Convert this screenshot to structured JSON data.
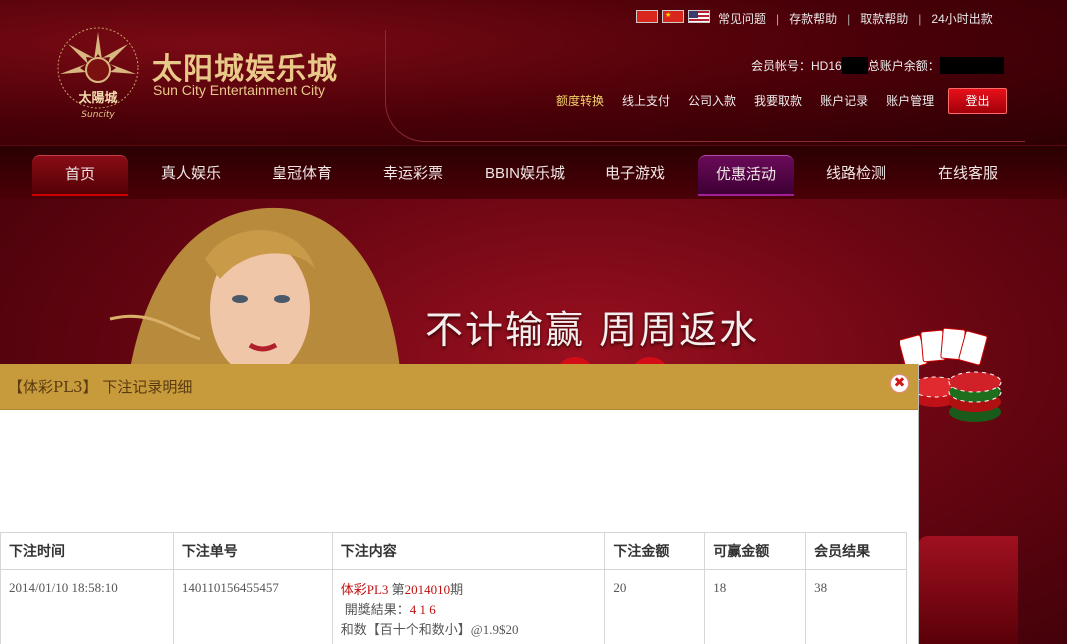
{
  "brand": {
    "name_cn": "太阳城娱乐城",
    "name_en": "Sun City Entertainment City",
    "emblem_text_cn": "太陽城",
    "emblem_text_en": "Suncity"
  },
  "top_links": [
    "常见问题",
    "存款帮助",
    "取款帮助",
    "24小时出款"
  ],
  "account": {
    "member_label": "会员帐号：",
    "member_id": "HD16",
    "balance_label": "总账户余额："
  },
  "account_nav": [
    "额度转换",
    "线上支付",
    "公司入款",
    "我要取款",
    "账户记录",
    "账户管理"
  ],
  "logout_label": "登出",
  "main_nav": [
    "首页",
    "真人娱乐",
    "皇冠体育",
    "幸运彩票",
    "BBIN娱乐城",
    "电子游戏",
    "优惠活动",
    "线路检测",
    "在线客服"
  ],
  "banner": {
    "slogan": "不计输赢  周周返水"
  },
  "dialog": {
    "title": "【体彩PL3】 下注记录明细",
    "close_symbol": "✖"
  },
  "table": {
    "headers": [
      "下注时间",
      "下注单号",
      "下注内容",
      "下注金额",
      "可赢金额",
      "会员结果"
    ],
    "rows": [
      {
        "time": "2014/01/10 18:58:10",
        "order_no": "140110156455457",
        "content_game": "体彩PL3",
        "content_issue_prefix": " 第",
        "content_issue": "2014010",
        "content_issue_suffix": "期",
        "content_result_label": "開獎結果：",
        "content_result": "4 1 6",
        "content_bet": "和数【百十个和数小】@1.9$20",
        "amount": "20",
        "win": "18",
        "result": "38"
      }
    ]
  },
  "colors": {
    "header_bg": "#4a0008",
    "dialog_header": "#c79b3c",
    "logout_red": "#e8101a",
    "promo_purple": "#6a0a58"
  }
}
